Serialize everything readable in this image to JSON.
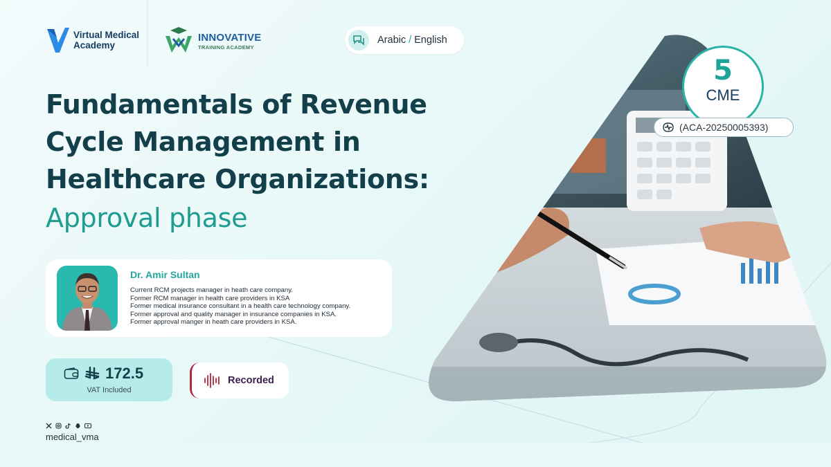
{
  "brand": {
    "vma_name": "Virtual Medical Academy",
    "ita_name": "INNOVATIVE",
    "ita_tagline": "TRAINING ACADEMY"
  },
  "language": {
    "primary": "Arabic",
    "separator": "/",
    "secondary": "English"
  },
  "course": {
    "title_lines": [
      "Fundamentals of Revenue",
      "Cycle Management in",
      "Healthcare Organizations:"
    ],
    "subtitle": "Approval phase"
  },
  "credits": {
    "value": "5",
    "unit": "CME",
    "code": "(ACA-20250005393)"
  },
  "speaker": {
    "name": "Dr. Amir Sultan",
    "bio": [
      "Current RCM projects manager in heath care company.",
      "Former RCM manager in health care providers in KSA",
      "Former medical insurance consultant in a health care technology company.",
      "Former approval and quality manager in insurance companies in KSA.",
      "Former approval manger in heath care providers in KSA."
    ]
  },
  "price": {
    "currency_symbol": "⃁",
    "amount": "172.5",
    "note": "VAT Included"
  },
  "format": {
    "label": "Recorded"
  },
  "social": {
    "handle": "medical_vma",
    "icons": [
      "x-icon",
      "instagram-icon",
      "tiktok-icon",
      "snapchat-icon",
      "youtube-icon"
    ]
  },
  "colors": {
    "primary": "#133f4b",
    "accent": "#1e9c8f",
    "mint": "#b5ecea",
    "recorded": "#b3263f"
  }
}
